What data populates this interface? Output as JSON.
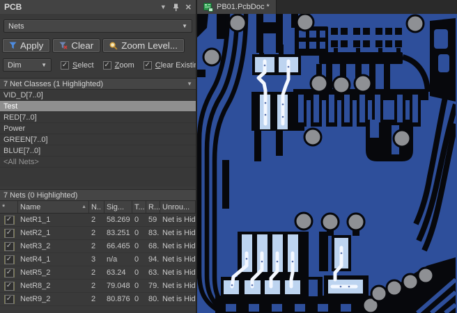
{
  "panel": {
    "title": "PCB",
    "selector": {
      "value": "Nets"
    },
    "buttons": {
      "apply": "Apply",
      "clear": "Clear",
      "zoom_level": "Zoom Level..."
    },
    "dim": {
      "value": "Dim"
    },
    "checkboxes": [
      {
        "label": "Select",
        "checked": "✓"
      },
      {
        "label": "Zoom",
        "checked": "✓"
      },
      {
        "label": "Clear Existing",
        "checked": "✓"
      }
    ],
    "classes": {
      "header": "7 Net Classes (1 Highlighted)",
      "items": [
        {
          "label": "VID_D[7..0]"
        },
        {
          "label": "Test",
          "selected": true
        },
        {
          "label": "RED[7..0]"
        },
        {
          "label": "Power"
        },
        {
          "label": "GREEN[7..0]"
        },
        {
          "label": "BLUE[7..0]"
        },
        {
          "label": "<All Nets>",
          "muted": true
        }
      ]
    },
    "nets": {
      "header": "7 Nets (0 Highlighted)",
      "columns": [
        "*",
        "Name",
        "N..",
        "Sig...",
        "T...",
        "R...",
        "Unrou..."
      ],
      "rows": [
        {
          "checked": "✓",
          "name": "NetR1_1",
          "nodes": "2",
          "signal": "58.269",
          "t": "0",
          "routed": "59",
          "unrouted": "Net is Hid"
        },
        {
          "checked": "✓",
          "name": "NetR2_1",
          "nodes": "2",
          "signal": "83.251",
          "t": "0",
          "routed": "83.",
          "unrouted": "Net is Hid"
        },
        {
          "checked": "✓",
          "name": "NetR3_2",
          "nodes": "2",
          "signal": "66.465",
          "t": "0",
          "routed": "68.",
          "unrouted": "Net is Hid"
        },
        {
          "checked": "✓",
          "name": "NetR4_1",
          "nodes": "3",
          "signal": "n/a",
          "t": "0",
          "routed": "94.",
          "unrouted": "Net is Hid"
        },
        {
          "checked": "✓",
          "name": "NetR5_2",
          "nodes": "2",
          "signal": "63.24",
          "t": "0",
          "routed": "63.",
          "unrouted": "Net is Hid"
        },
        {
          "checked": "✓",
          "name": "NetR8_2",
          "nodes": "2",
          "signal": "79.048",
          "t": "0",
          "routed": "79.",
          "unrouted": "Net is Hid"
        },
        {
          "checked": "✓",
          "name": "NetR9_2",
          "nodes": "2",
          "signal": "80.876",
          "t": "0",
          "routed": "80.",
          "unrouted": "Net is Hid"
        }
      ]
    }
  },
  "editor": {
    "tab": {
      "label": "PB01.PcbDoc *"
    }
  },
  "colors": {
    "c-board": "#2e4f9b",
    "c-copper": "#07080c",
    "c-via": "#8e9094",
    "c-pad": "#bdd4f0",
    "c-trace": "#f4f8ff",
    "c-accent-green": "#2e9e4f",
    "c-funnel-blue": "#4d8be0",
    "c-magnifier-gold": "#dda63e",
    "c-clear-red": "#d04040"
  }
}
